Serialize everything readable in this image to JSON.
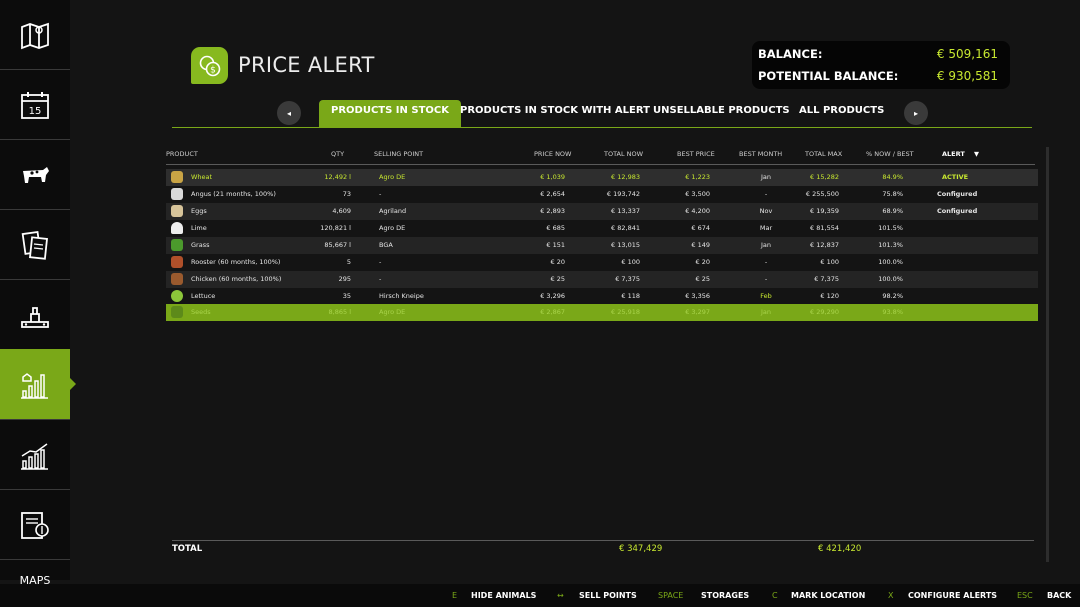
{
  "sidebar": {
    "bottom_label": "MAPS"
  },
  "header": {
    "title": "PRICE ALERT",
    "balance_label": "BALANCE:",
    "balance_value": "€ 509,161",
    "potential_label": "POTENTIAL BALANCE:",
    "potential_value": "€ 930,581"
  },
  "tabs": {
    "prev": "◂",
    "next": "▸",
    "items": [
      "PRODUCTS IN STOCK",
      "PRODUCTS IN STOCK WITH ALERT",
      "UNSELLABLE PRODUCTS",
      "ALL PRODUCTS"
    ]
  },
  "table": {
    "columns": {
      "product": "PRODUCT",
      "qty": "QTY",
      "selling_point": "SELLING POINT",
      "price_now": "PRICE NOW",
      "total_now": "TOTAL NOW",
      "best_price": "BEST PRICE",
      "best_month": "BEST MONTH",
      "total_max": "TOTAL MAX",
      "pct": "% NOW / BEST",
      "alert": "ALERT",
      "alert_sort": "▼"
    },
    "rows": [
      {
        "product": "Wheat",
        "qty": "12,492 l",
        "selling_point": "Agro DE",
        "price_now": "€ 1,039",
        "total_now": "€ 12,983",
        "best_price": "€ 1,223",
        "best_month": "Jan",
        "total_max": "€ 15,282",
        "pct": "84.9%",
        "alert": "ACTIVE"
      },
      {
        "product": "Angus (21 months, 100%)",
        "qty": "73",
        "selling_point": "-",
        "price_now": "€ 2,654",
        "total_now": "€ 193,742",
        "best_price": "€ 3,500",
        "best_month": "-",
        "total_max": "€ 255,500",
        "pct": "75.8%",
        "alert": "Configured"
      },
      {
        "product": "Eggs",
        "qty": "4,609",
        "selling_point": "Agriland",
        "price_now": "€ 2,893",
        "total_now": "€ 13,337",
        "best_price": "€ 4,200",
        "best_month": "Nov",
        "total_max": "€ 19,359",
        "pct": "68.9%",
        "alert": "Configured"
      },
      {
        "product": "Lime",
        "qty": "120,821 l",
        "selling_point": "Agro DE",
        "price_now": "€ 685",
        "total_now": "€ 82,841",
        "best_price": "€ 674",
        "best_month": "Mar",
        "total_max": "€ 81,554",
        "pct": "101.5%",
        "alert": ""
      },
      {
        "product": "Grass",
        "qty": "85,667 l",
        "selling_point": "BGA",
        "price_now": "€ 151",
        "total_now": "€ 13,015",
        "best_price": "€ 149",
        "best_month": "Jan",
        "total_max": "€ 12,837",
        "pct": "101.3%",
        "alert": ""
      },
      {
        "product": "Rooster (60 months, 100%)",
        "qty": "5",
        "selling_point": "-",
        "price_now": "€ 20",
        "total_now": "€ 100",
        "best_price": "€ 20",
        "best_month": "-",
        "total_max": "€ 100",
        "pct": "100.0%",
        "alert": ""
      },
      {
        "product": "Chicken (60 months, 100%)",
        "qty": "295",
        "selling_point": "-",
        "price_now": "€ 25",
        "total_now": "€ 7,375",
        "best_price": "€ 25",
        "best_month": "-",
        "total_max": "€ 7,375",
        "pct": "100.0%",
        "alert": ""
      },
      {
        "product": "Lettuce",
        "qty": "35",
        "selling_point": "Hirsch Kneipe",
        "price_now": "€ 3,296",
        "total_now": "€ 118",
        "best_price": "€ 3,356",
        "best_month": "Feb",
        "total_max": "€ 120",
        "pct": "98.2%",
        "alert": ""
      },
      {
        "product": "Seeds",
        "qty": "8,865 l",
        "selling_point": "Agro DE",
        "price_now": "€ 2,867",
        "total_now": "€ 25,918",
        "best_price": "€ 3,297",
        "best_month": "Jan",
        "total_max": "€ 29,290",
        "pct": "93.8%",
        "alert": ""
      }
    ],
    "total_label": "TOTAL",
    "total_now": "€ 347,429",
    "total_max": "€ 421,420"
  },
  "footer": {
    "items": [
      {
        "key": "E",
        "label": "HIDE ANIMALS"
      },
      {
        "key": "↔",
        "label": "SELL POINTS"
      },
      {
        "key": "SPACE",
        "label": "STORAGES"
      },
      {
        "key": "C",
        "label": "MARK LOCATION"
      },
      {
        "key": "X",
        "label": "CONFIGURE ALERTS"
      },
      {
        "key": "ESC",
        "label": "BACK"
      }
    ]
  },
  "colors": {
    "accent": "#7aa818",
    "value_highlight": "#c8e830",
    "background": "#141414"
  },
  "icons": [
    "map-icon",
    "calendar-icon",
    "cow-icon",
    "contracts-icon",
    "production-icon",
    "price-alert-icon",
    "statistics-icon",
    "finances-icon",
    "coins-icon"
  ]
}
